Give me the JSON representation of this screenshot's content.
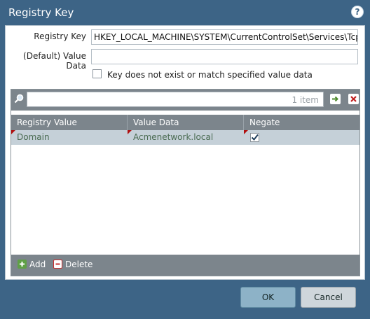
{
  "dialog": {
    "title": "Registry Key",
    "help_icon": "help-icon"
  },
  "form": {
    "registry_key_label": "Registry Key",
    "registry_key_value": "HKEY_LOCAL_MACHINE\\SYSTEM\\CurrentControlSet\\Services\\Tcpip\\Pa",
    "default_value_label": "(Default) Value Data",
    "default_value_value": "",
    "negate_key_label": "Key does not exist or match specified value data",
    "negate_key_checked": false
  },
  "grid": {
    "search_value": "",
    "count": "1 item",
    "columns": [
      "Registry Value",
      "Value Data",
      "Negate"
    ],
    "rows": [
      {
        "registry_value": "Domain",
        "value_data": "Acmenetwork.local",
        "negate": true
      }
    ],
    "add_label": "Add",
    "delete_label": "Delete"
  },
  "buttons": {
    "ok": "OK",
    "cancel": "Cancel"
  },
  "colors": {
    "titlebar": "#3d6486",
    "grid_toolbar": "#7c858c",
    "row_selected": "#c5d0d8",
    "ok_button": "#8db2c7",
    "add_icon": "#5fa046",
    "delete_icon": "#c83030"
  }
}
